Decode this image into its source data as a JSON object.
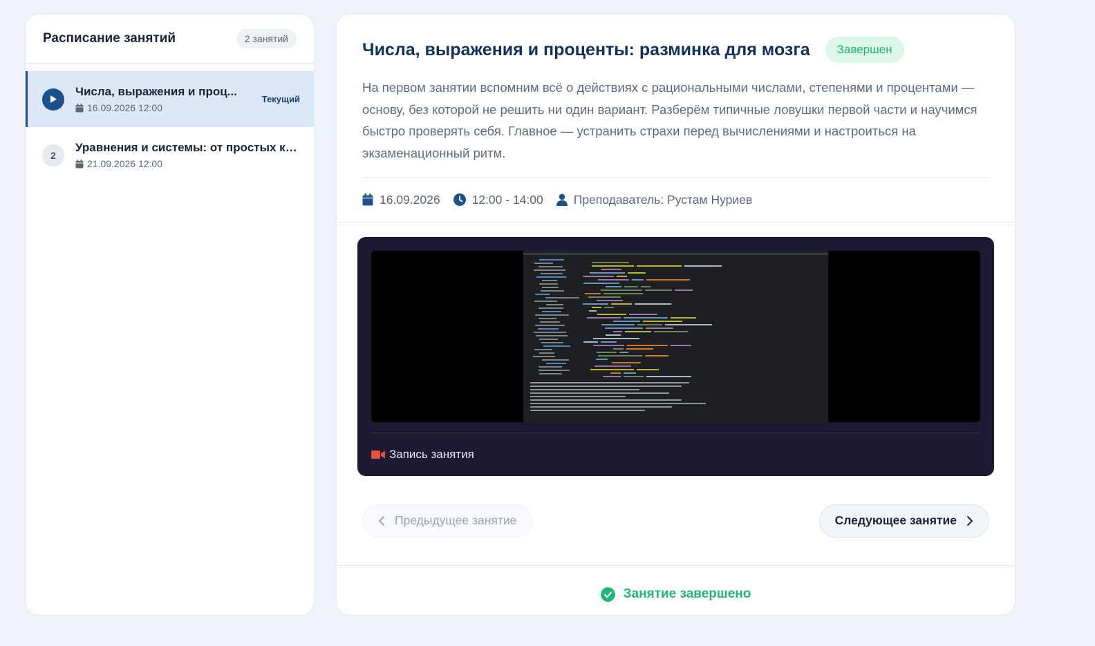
{
  "sidebar": {
    "title": "Расписание занятий",
    "count": "2 занятий",
    "items": [
      {
        "number": "",
        "title": "Числа, выражения и проц...",
        "date": "16.09.2026 12:00",
        "current_label": "Текущий"
      },
      {
        "number": "2",
        "title": "Уравнения и системы: от простых к те...",
        "date": "21.09.2026 12:00"
      }
    ]
  },
  "lesson": {
    "title": "Числа, выражения и проценты: разминка для мозга",
    "status": "Завершен",
    "description": "На первом занятии вспомним всё о действиях с рациональными числами, степенями и процентами — основу, без которой не решить ни один вариант. Разберём типичные ловушки первой части и научимся быстро проверять себя. Главное — устранить страхи перед вычислениями и настроиться на экзаменационный ритм.",
    "date": "16.09.2026",
    "time": "12:00 - 14:00",
    "teacher": "Преподаватель: Рустам Нуриев"
  },
  "player": {
    "caption": "Запись занятия"
  },
  "navigation": {
    "prev_label": "Предыдущее занятие",
    "next_label": "Следующее занятие"
  },
  "footer": {
    "completed_label": "Занятие завершено"
  },
  "colors": {
    "accent": "#1d4f8c",
    "success": "#22b673",
    "title": "#13315c",
    "player_bg": "#1c1a32"
  }
}
